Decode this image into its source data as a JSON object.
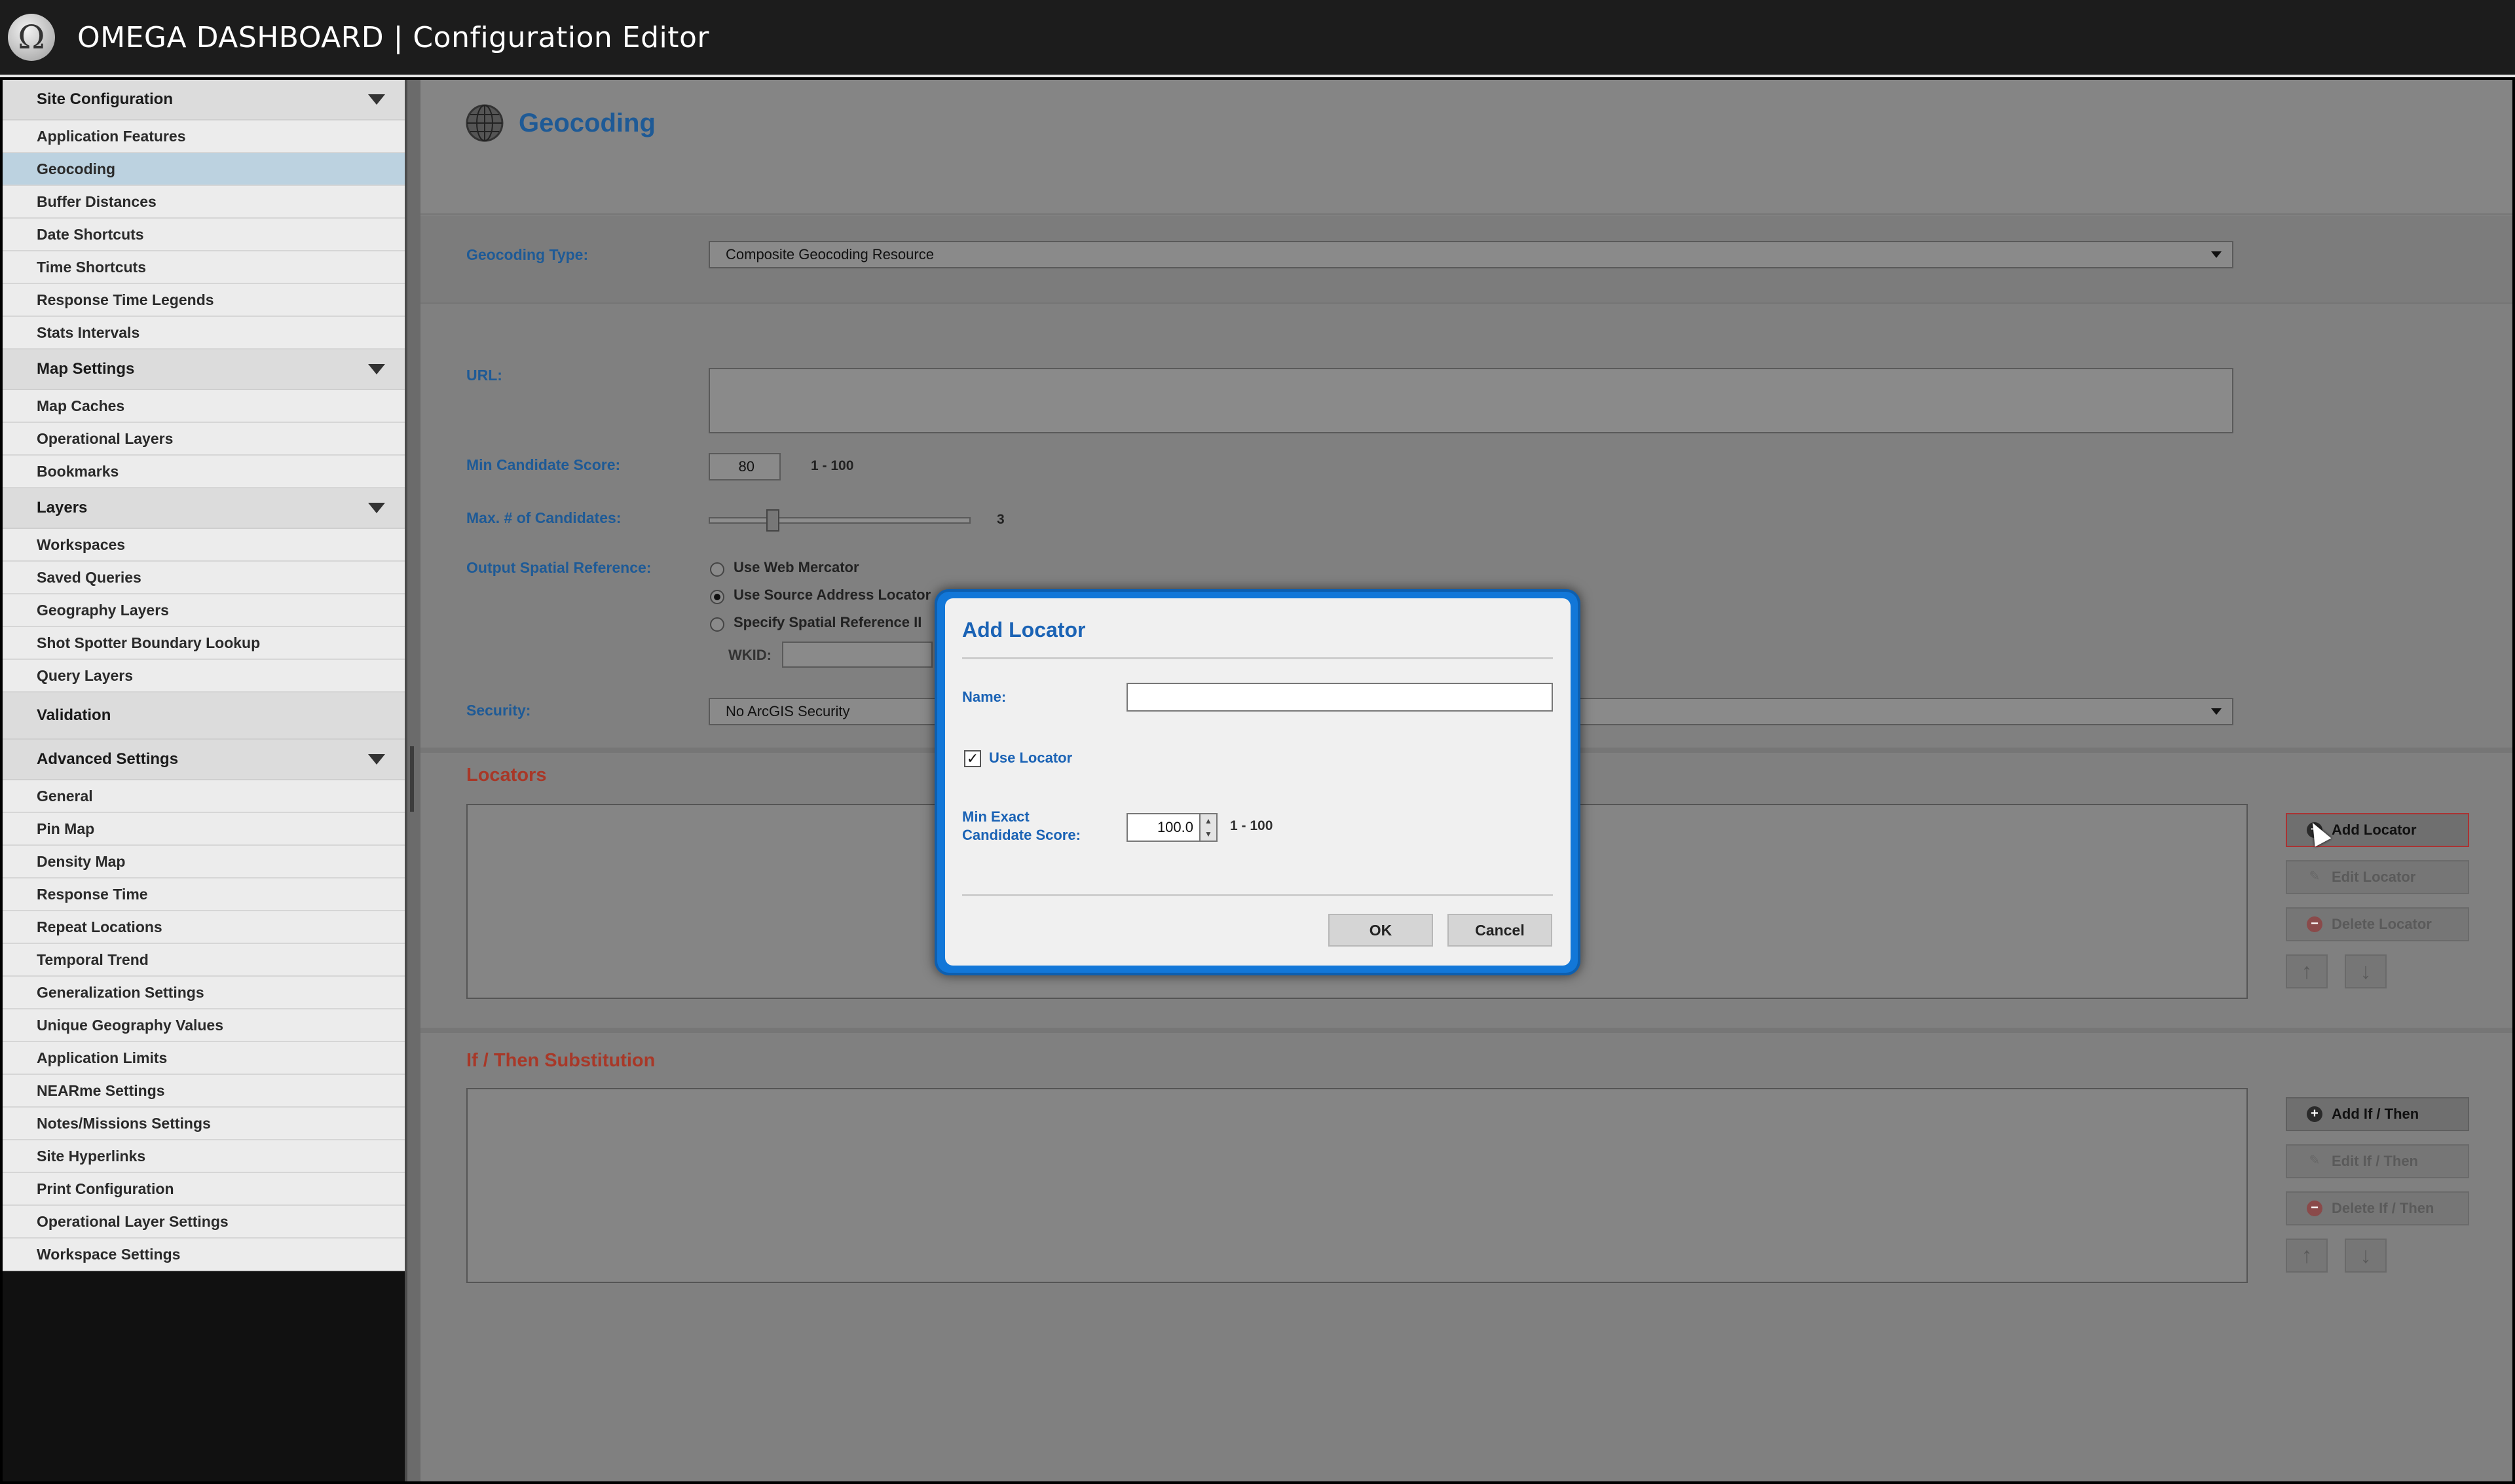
{
  "app": {
    "title": "OMEGA DASHBOARD | Configuration Editor",
    "logo_glyph": "Ω"
  },
  "sidebar": {
    "sections": [
      {
        "label": "Site Configuration",
        "items": [
          "Application Features",
          "Geocoding",
          "Buffer Distances",
          "Date Shortcuts",
          "Time Shortcuts",
          "Response Time Legends",
          "Stats Intervals"
        ],
        "active": "Geocoding"
      },
      {
        "label": "Map Settings",
        "items": [
          "Map Caches",
          "Operational Layers",
          "Bookmarks"
        ]
      },
      {
        "label": "Layers",
        "items": [
          "Workspaces",
          "Saved Queries",
          "Geography Layers",
          "Shot Spotter Boundary Lookup",
          "Query Layers"
        ]
      },
      {
        "label": "Validation",
        "items": []
      },
      {
        "label": "Advanced Settings",
        "items": [
          "General",
          "Pin Map",
          "Density Map",
          "Response Time",
          "Repeat Locations",
          "Temporal Trend",
          "Generalization Settings",
          "Unique Geography Values",
          "Application Limits",
          "NEARme Settings",
          "Notes/Missions Settings",
          "Site Hyperlinks",
          "Print Configuration",
          "Operational Layer Settings",
          "Workspace Settings"
        ]
      }
    ]
  },
  "page": {
    "title": "Geocoding",
    "geocoding_type_label": "Geocoding Type:",
    "geocoding_type_value": "Composite Geocoding Resource",
    "url_label": "URL:",
    "url_value": "",
    "min_candidate_label": "Min Candidate Score:",
    "min_candidate_value": "80",
    "min_candidate_range": "1 - 100",
    "max_candidates_label": "Max. # of Candidates:",
    "max_candidates_value": "3",
    "output_sr_label": "Output Spatial Reference:",
    "output_sr_options": [
      "Use Web Mercator",
      "Use Source Address Locator",
      "Specify Spatial Reference II"
    ],
    "output_sr_selected": "Use Source Address Locator",
    "wkid_label": "WKID:",
    "security_label": "Security:",
    "security_value": "No ArcGIS Security",
    "locators_title": "Locators",
    "locator_buttons": {
      "add": "Add Locator",
      "edit": "Edit Locator",
      "delete": "Delete Locator"
    },
    "ifthen_title": "If / Then Substitution",
    "ifthen_buttons": {
      "add": "Add If / Then",
      "edit": "Edit If / Then",
      "delete": "Delete If / Then"
    },
    "up_glyph": "↑",
    "down_glyph": "↓"
  },
  "dialog": {
    "title": "Add Locator",
    "name_label": "Name:",
    "name_value": "",
    "use_locator_label": "Use Locator",
    "use_locator_checked": true,
    "score_label_line1": "Min Exact",
    "score_label_line2": "Candidate Score:",
    "score_value": "100.0",
    "score_range": "1 - 100",
    "ok_label": "OK",
    "cancel_label": "Cancel"
  },
  "colors": {
    "accent_blue": "#1b63b5",
    "dialog_frame": "#1277d8",
    "section_red": "#a83828",
    "active_nav": "#bcd2e0"
  }
}
